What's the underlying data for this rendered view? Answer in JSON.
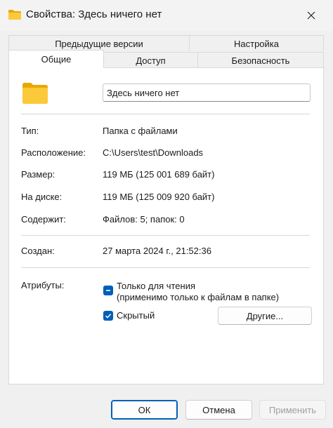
{
  "window": {
    "title": "Свойства: Здесь ничего нет",
    "close_icon": "close-icon",
    "folder_icon": "folder-icon"
  },
  "tabs": {
    "row_back": [
      {
        "label": "Предыдущие версии"
      },
      {
        "label": "Настройка"
      }
    ],
    "row_front": [
      {
        "label": "Общие",
        "active": true
      },
      {
        "label": "Доступ"
      },
      {
        "label": "Безопасность"
      }
    ]
  },
  "general": {
    "folder_name": "Здесь ничего нет",
    "rows": [
      {
        "label": "Тип:",
        "value": "Папка с файлами"
      },
      {
        "label": "Расположение:",
        "value": "C:\\Users\\test\\Downloads"
      },
      {
        "label": "Размер:",
        "value": "119 МБ (125 001 689 байт)"
      },
      {
        "label": "На диске:",
        "value": "119 МБ (125 009 920 байт)"
      },
      {
        "label": "Содержит:",
        "value": "Файлов: 5; папок: 0"
      }
    ],
    "created": {
      "label": "Создан:",
      "value": "27 марта 2024 г., 21:52:36"
    },
    "attributes": {
      "label": "Атрибуты:",
      "readonly_label": "Только для чтения",
      "readonly_note": "(применимо только к файлам в папке)",
      "readonly_state": "indeterminate",
      "hidden_label": "Скрытый",
      "hidden_state": "checked",
      "other_button": "Другие..."
    }
  },
  "footer": {
    "ok": "ОК",
    "cancel": "Отмена",
    "apply": "Применить"
  },
  "colors": {
    "accent": "#005fb8",
    "folder": "#f8c847"
  }
}
